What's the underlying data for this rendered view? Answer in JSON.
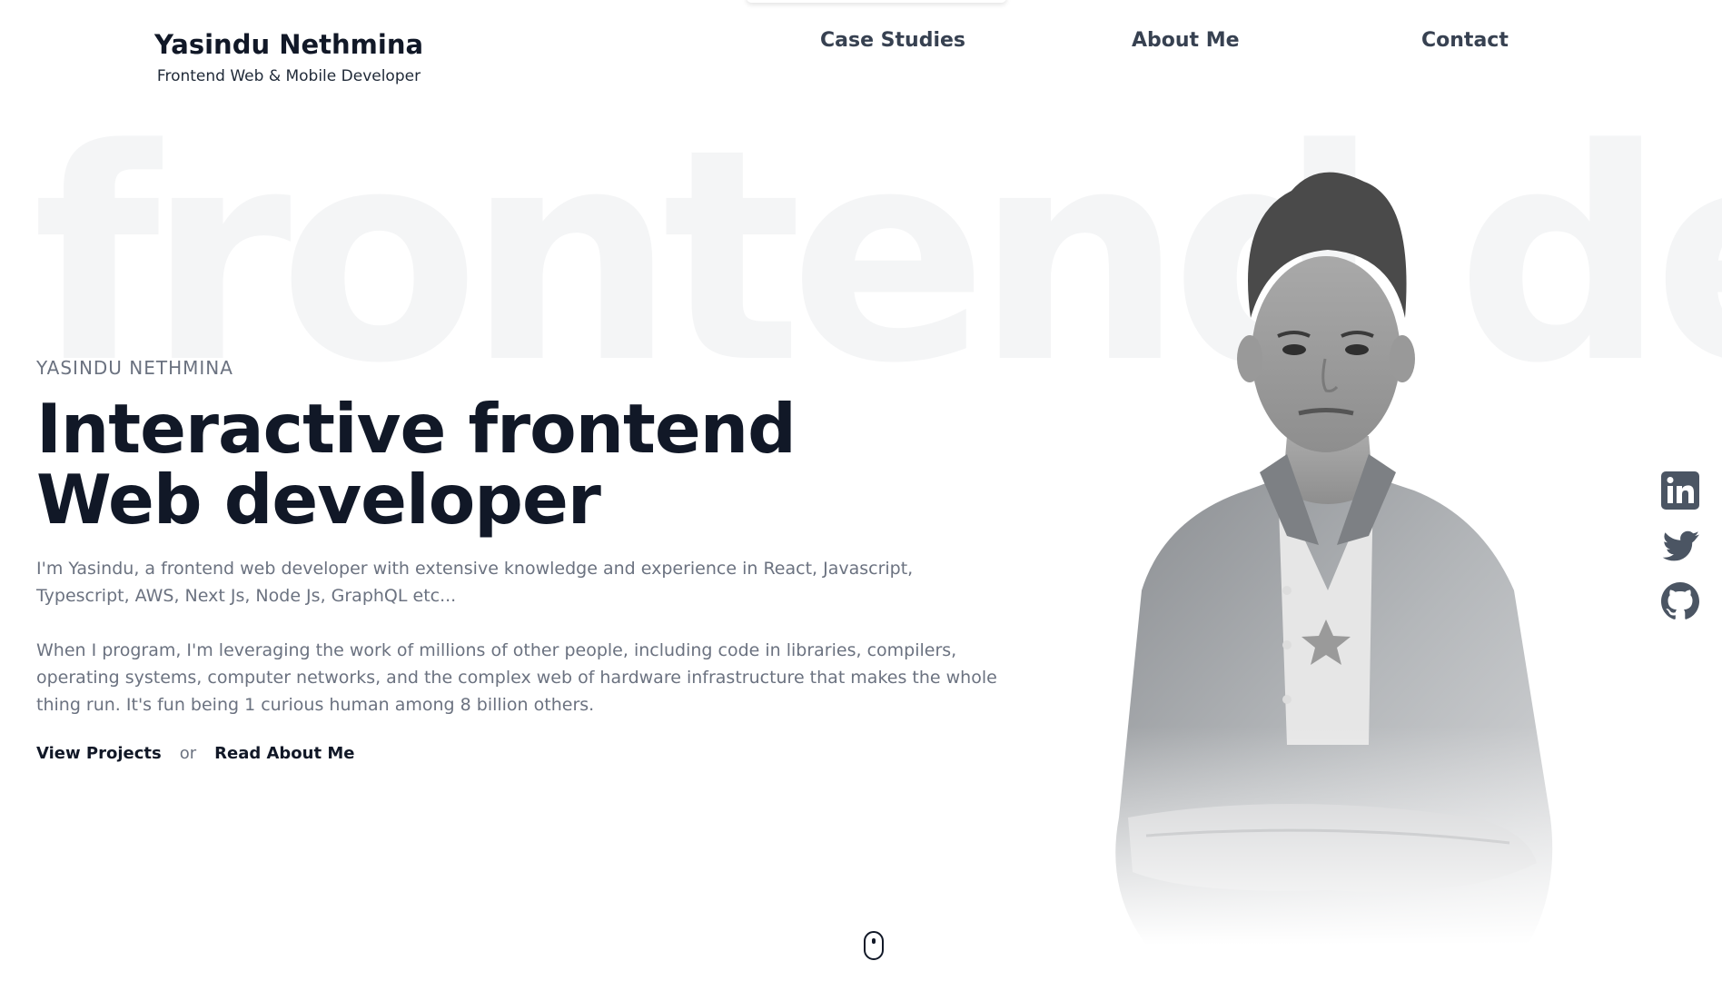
{
  "header": {
    "brand_name": "Yasindu Nethmina",
    "brand_role": "Frontend Web & Mobile Developer"
  },
  "nav": {
    "items": [
      {
        "label": "Case Studies"
      },
      {
        "label": "About Me"
      },
      {
        "label": "Contact"
      }
    ]
  },
  "hero": {
    "watermark": "frontend dev.",
    "eyebrow": "YASINDU NETHMINA",
    "headline_line1": "Interactive frontend",
    "headline_line2": "Web developer",
    "intro": "I'm Yasindu, a frontend web developer with extensive knowledge and experience in React, Javascript, Typescript, AWS, Next Js, Node Js, GraphQL etc...",
    "bio": "When I program, I'm leveraging the work of millions of other people, including code in libraries, compilers, operating systems, computer networks, and the complex web of hardware infrastructure that makes the whole thing run. It's fun being 1 curious human among 8 billion others.",
    "cta_primary": "View Projects",
    "cta_separator": "or",
    "cta_secondary": "Read About Me"
  },
  "social": {
    "icons": [
      "linkedin-icon",
      "twitter-icon",
      "github-icon"
    ],
    "color": "#4b5563"
  },
  "scroll_indicator": {
    "icon": "mouse-scroll-icon"
  },
  "colors": {
    "text_primary": "#111827",
    "text_muted": "#6b7280",
    "nav_text": "#374151",
    "watermark": "#f4f5f6",
    "background": "#ffffff"
  }
}
